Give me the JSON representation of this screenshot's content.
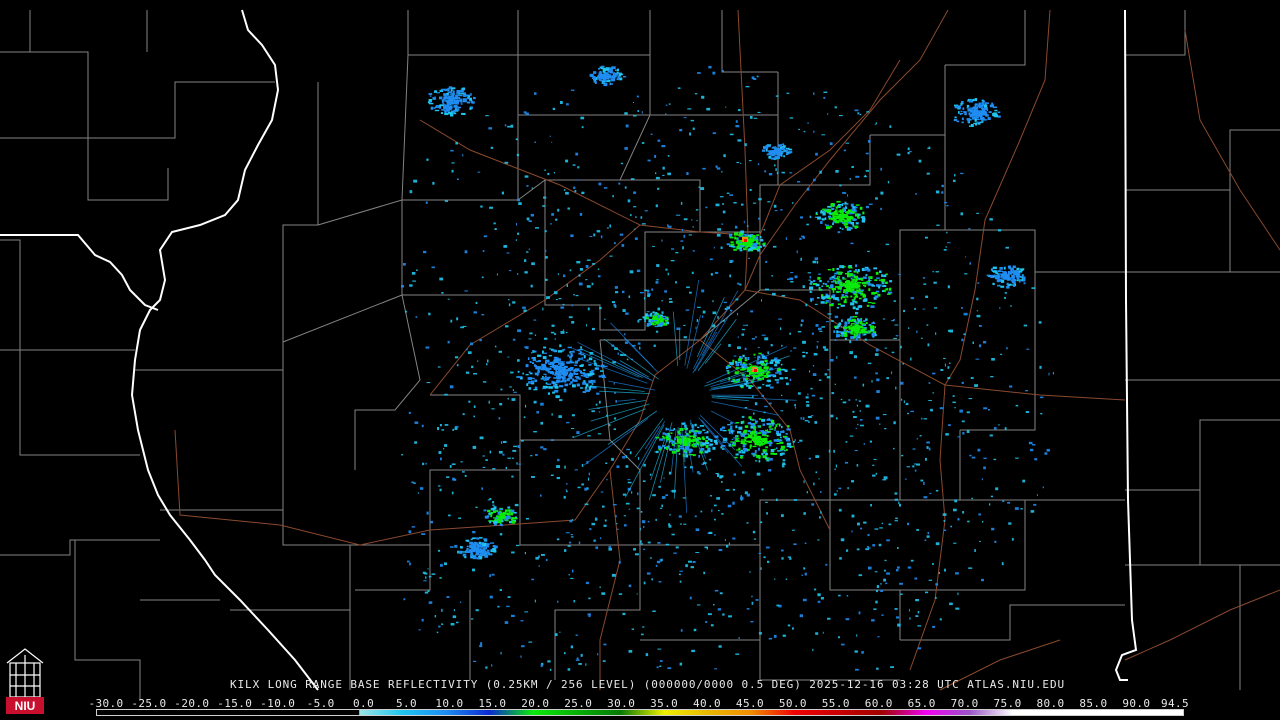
{
  "product": {
    "caption": "KILX LONG RANGE BASE REFLECTIVITY (0.25KM / 256 LEVEL) (000000/0000 0.5 DEG) 2025-12-16 03:28 UTC  ATLAS.NIU.EDU"
  },
  "colorbar": {
    "labels": [
      "-30.0",
      "-25.0",
      "-20.0",
      "-15.0",
      "-10.0",
      "-5.0",
      "0.0",
      "5.0",
      "10.0",
      "15.0",
      "20.0",
      "25.0",
      "30.0",
      "35.0",
      "40.0",
      "45.0",
      "50.0",
      "55.0",
      "60.0",
      "65.0",
      "70.0",
      "75.0",
      "80.0",
      "85.0",
      "90.0",
      "94.5"
    ],
    "stops": [
      {
        "dbz": -30,
        "color": "#000000"
      },
      {
        "dbz": 0,
        "color": "#000000"
      },
      {
        "dbz": 0.1,
        "color": "#9ce5e5"
      },
      {
        "dbz": 5,
        "color": "#1fc5f0"
      },
      {
        "dbz": 10,
        "color": "#1e8cf0"
      },
      {
        "dbz": 15,
        "color": "#0a2ad0"
      },
      {
        "dbz": 20,
        "color": "#0bea0b"
      },
      {
        "dbz": 25,
        "color": "#07b007"
      },
      {
        "dbz": 30,
        "color": "#067a06"
      },
      {
        "dbz": 35,
        "color": "#f0f000"
      },
      {
        "dbz": 40,
        "color": "#e8b800"
      },
      {
        "dbz": 45,
        "color": "#f08c00"
      },
      {
        "dbz": 50,
        "color": "#f00000"
      },
      {
        "dbz": 55,
        "color": "#c80000"
      },
      {
        "dbz": 60,
        "color": "#a00000"
      },
      {
        "dbz": 65,
        "color": "#f000f0"
      },
      {
        "dbz": 70,
        "color": "#9a55c8"
      },
      {
        "dbz": 75,
        "color": "#ffffff"
      },
      {
        "dbz": 94.5,
        "color": "#ffffff"
      }
    ]
  },
  "map_colors": {
    "background": "#000000",
    "county_lines": "#9a9a9a",
    "state_lines": "#ffffff",
    "roads": "#8a4a2e"
  },
  "radar": {
    "site": "KILX",
    "echo_colors": [
      "#1fc5f0",
      "#1e8cf0",
      "#0bea0b",
      "#f0f000",
      "#f08c00",
      "#f00000"
    ]
  },
  "logo": {
    "text": "NIU",
    "color": "#c8102e"
  }
}
